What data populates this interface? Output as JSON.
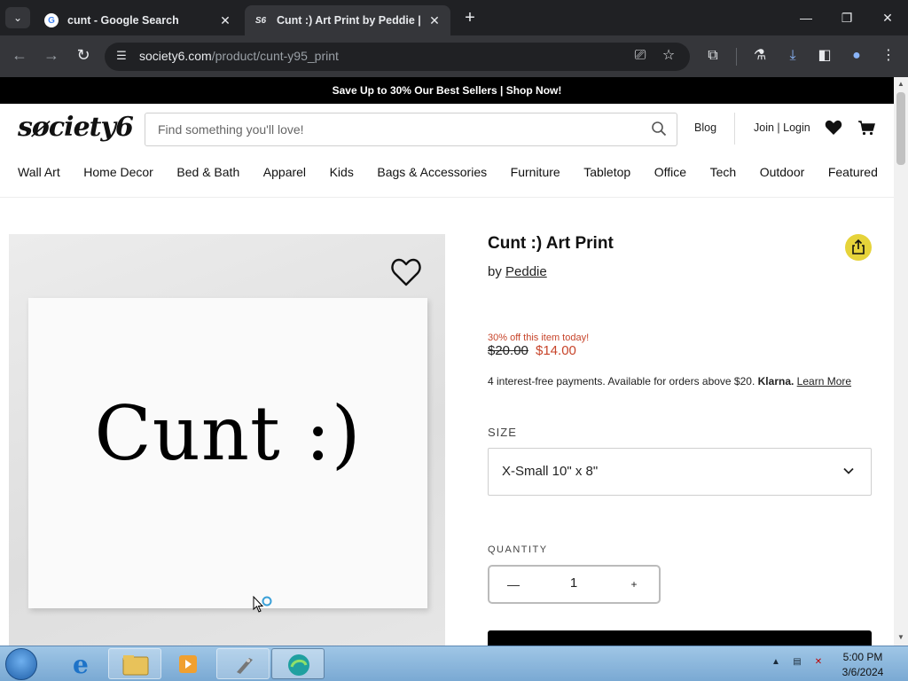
{
  "browser": {
    "tabs": [
      {
        "title": "cunt - Google Search",
        "favicon": "google-icon"
      },
      {
        "title": "Cunt :) Art Print by Peddie | Society6",
        "favicon": "society6-icon"
      }
    ],
    "url_host": "society6.com",
    "url_path": "/product/cunt-y95_print"
  },
  "page": {
    "promo": "Save Up to 30% Our Best Sellers | Shop Now!",
    "logo": "søciety6",
    "search_placeholder": "Find something you'll love!",
    "header_links": {
      "blog": "Blog",
      "join_login": "Join | Login"
    },
    "categories": [
      "Wall Art",
      "Home Decor",
      "Bed & Bath",
      "Apparel",
      "Kids",
      "Bags & Accessories",
      "Furniture",
      "Tabletop",
      "Office",
      "Tech",
      "Outdoor",
      "Featured"
    ],
    "product": {
      "artwork_text": "Cunt :)",
      "title": "Cunt :) Art Print",
      "by": "by",
      "artist": "Peddie",
      "discount_note": "30% off this item today!",
      "old_price": "$20.00",
      "new_price": "$14.00",
      "klarna_text": "4 interest-free payments. Available for orders above $20.",
      "klarna_brand": "Klarna.",
      "klarna_learn": "Learn More",
      "size_label": "SIZE",
      "size_value": "X-Small 10\" x 8\"",
      "quantity_label": "QUANTITY",
      "quantity_value": "1",
      "qty_minus": "—",
      "qty_plus": "+"
    }
  },
  "taskbar": {
    "time": "5:00 PM",
    "date": "3/6/2024"
  },
  "colors": {
    "accent_sale": "#c7442a",
    "share_button": "#e6d33a",
    "browser_dark": "#202124"
  }
}
